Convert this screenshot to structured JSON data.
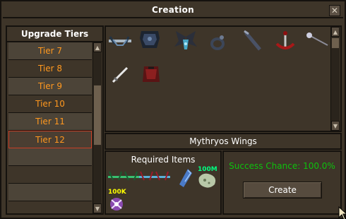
{
  "window": {
    "title": "Creation",
    "close_icon": "close-icon"
  },
  "tiers": {
    "header": "Upgrade Tiers",
    "items": [
      "Tier 7",
      "Tier 8",
      "Tier 9",
      "Tier 10",
      "Tier 11",
      "Tier 12",
      "",
      "",
      ""
    ],
    "selected": "Tier 12"
  },
  "items": {
    "icons": [
      "armadyl-crossbow-icon",
      "dragon-armour-icon",
      "demon-wings-icon",
      "ring-icon",
      "staff-icon",
      "anchor-icon",
      "wand-icon",
      "dagger-icon",
      "red-cape-icon"
    ]
  },
  "selected_item": {
    "name": "Mythryos Wings"
  },
  "required": {
    "title": "Required Items",
    "items": [
      {
        "icon": "green-crossbow-icon",
        "qty": ""
      },
      {
        "icon": "green-crossbow-icon",
        "qty": ""
      },
      {
        "icon": "blue-crossbow-icon",
        "qty": ""
      },
      {
        "icon": "blue-crossbow-icon",
        "qty": ""
      },
      {
        "icon": "blue-crystal-icon",
        "qty": ""
      },
      {
        "icon": "pale-gem-icon",
        "qty": "100M"
      },
      {
        "icon": "purple-orb-icon",
        "qty": "100K"
      }
    ]
  },
  "action": {
    "chance_label": "Success Chance: 100.0%",
    "create_label": "Create"
  },
  "colors": {
    "accent_orange": "#ff981f",
    "success_green": "#0dc10d",
    "selected_border": "#c83e26"
  }
}
